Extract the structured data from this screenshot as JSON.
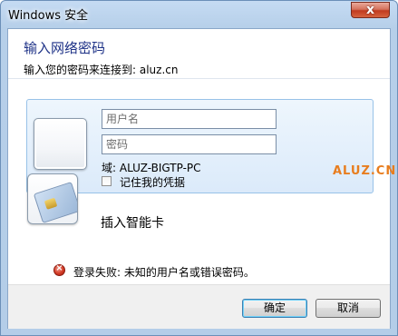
{
  "window": {
    "title": "Windows 安全",
    "close_glyph": "x"
  },
  "header": {
    "heading": "输入网络密码",
    "subheading": "输入您的密码来连接到: aluz.cn"
  },
  "credentials": {
    "username_placeholder": "用户名",
    "username_value": "",
    "password_placeholder": "密码",
    "password_value": "",
    "domain_text": "域: ALUZ-BIGTP-PC",
    "remember_label": "记住我的凭据",
    "remember_checked": false
  },
  "watermark": "ALUZ.CN",
  "smartcard": {
    "label": "插入智能卡"
  },
  "error": {
    "message": "登录失败: 未知的用户名或错误密码。",
    "icon": "error-x-icon"
  },
  "buttons": {
    "ok_label": "确定",
    "cancel_label": "取消"
  },
  "colors": {
    "heading": "#1e3287",
    "watermark": "#e87d1e",
    "close_button": "#c13b1f"
  }
}
